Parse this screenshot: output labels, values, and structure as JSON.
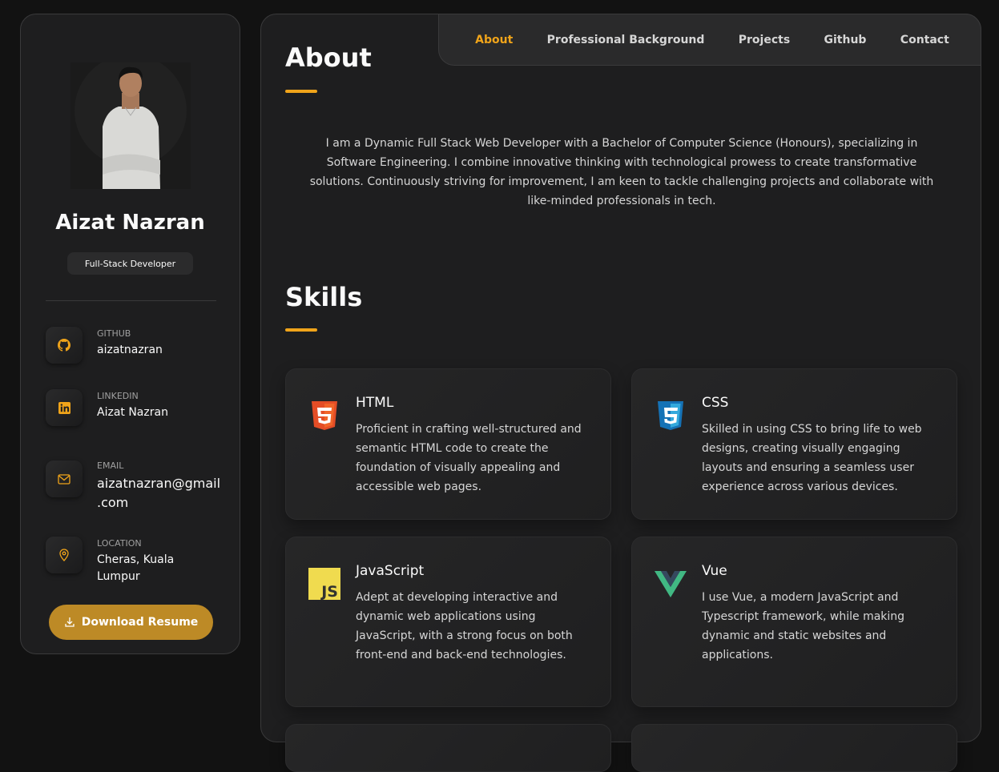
{
  "profile": {
    "name": "Aizat Nazran",
    "role": "Full-Stack Developer"
  },
  "contacts": [
    {
      "label": "GITHUB",
      "value": "aizatnazran",
      "icon": "github-icon"
    },
    {
      "label": "LINKEDIN",
      "value": "Aizat Nazran",
      "icon": "linkedin-icon"
    },
    {
      "label": "EMAIL",
      "value_line1": "aizatnazran@gmail",
      "value_line2": ".com",
      "icon": "mail-icon"
    },
    {
      "label": "LOCATION",
      "value_line1": "Cheras, Kuala",
      "value_line2": "Lumpur",
      "icon": "location-pin-icon"
    }
  ],
  "download_button": "Download Resume",
  "nav": [
    "About",
    "Professional Background",
    "Projects",
    "Github",
    "Contact"
  ],
  "about": {
    "heading": "About",
    "text": "I am a Dynamic Full Stack Web Developer with a Bachelor of Computer Science (Honours), specializing in Software Engineering. I combine innovative thinking with technological prowess to create transformative solutions. Continuously striving for improvement, I am keen to tackle challenging projects and collaborate with like-minded professionals in tech."
  },
  "skills": {
    "heading": "Skills",
    "items": [
      {
        "title": "HTML",
        "desc": "Proficient in crafting well-structured and semantic HTML code to create the foundation of visually appealing and accessible web pages.",
        "icon": "html5-icon"
      },
      {
        "title": "CSS",
        "desc": "Skilled in using CSS to bring life to web designs, creating visually engaging layouts and ensuring a seamless user experience across various devices.",
        "icon": "css3-icon"
      },
      {
        "title": "JavaScript",
        "desc": "Adept at developing interactive and dynamic web applications using JavaScript, with a strong focus on both front-end and back-end technologies.",
        "icon": "javascript-icon"
      },
      {
        "title": "Vue",
        "desc": "I use Vue, a modern JavaScript and Typescript framework, while making dynamic and static websites and applications.",
        "icon": "vue-icon"
      }
    ]
  },
  "colors": {
    "accent": "#f0a41a",
    "download": "#bd8a26",
    "panel": "#1e1e1f",
    "background": "#121212"
  }
}
